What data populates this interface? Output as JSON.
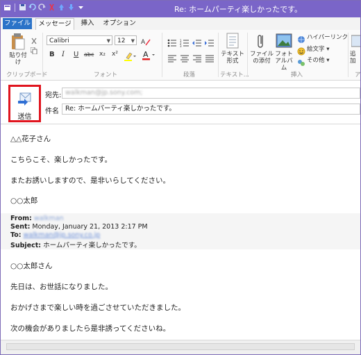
{
  "window": {
    "title": "Re: ホームパーティ楽しかったです。"
  },
  "tabs": [
    {
      "label": "ファイル"
    },
    {
      "label": "メッセージ"
    },
    {
      "label": "挿入"
    },
    {
      "label": "オプション"
    }
  ],
  "ribbon": {
    "paste_label": "貼り付け",
    "clipboard_group": "クリップボード",
    "font_name": "Calibri",
    "font_size": "12",
    "font_group": "フォント",
    "bold": "B",
    "italic": "I",
    "underline": "U",
    "strike": "abc",
    "subscript": "x₂",
    "superscript": "x²",
    "paragraph_group": "段落",
    "plaintext_label": "テキスト形式",
    "text_group": "テキスト...",
    "attach_label": "ファイルの添付",
    "photo_label": "フォトアルバム",
    "hyperlink_label": "ハイパーリンク",
    "emoji_label": "絵文字 ▾",
    "other_label": "その他 ▾",
    "insert_group": "挿入",
    "add_label": "追加",
    "overflow_group": "ア"
  },
  "compose": {
    "send_label": "送信",
    "to_label": "宛先:",
    "to_value": "walkman@jp.sony.com;",
    "subject_label": "件名",
    "subject_value": "Re: ホームパーティ楽しかったです。"
  },
  "message": {
    "line1": "△△花子さん",
    "line2": "こちらこそ、楽しかったです。",
    "line3": "またお誘いしますので、是非いらしてください。",
    "line4": "○○太郎",
    "quoted_header": {
      "from_label": "From:",
      "from_value": "walkman",
      "sent_label": "Sent:",
      "sent_value": "Monday, January 21, 2013 2:17 PM",
      "to_label": "To:",
      "to_value": "walkman@jp.sony.co.jp",
      "subject_label": "Subject:",
      "subject_value": "ホームパーティ楽しかったです。"
    },
    "line5": "○○太郎さん",
    "line6": "先日は、お世話になりました。",
    "line7": "おかげさまで楽しい時を過ごさせていただきました。",
    "line8": "次の機会がありましたら是非誘ってくださいね。"
  },
  "colors": {
    "titlebar": "#7a65c8",
    "file_tab": "#2b73c8",
    "highlight": "#e0141e"
  }
}
